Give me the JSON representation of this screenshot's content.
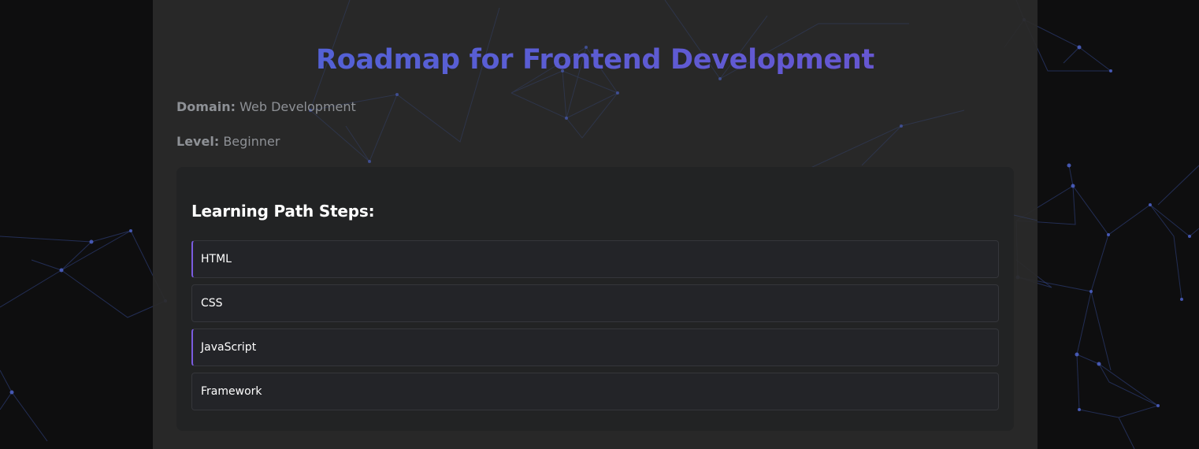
{
  "page": {
    "title": "Roadmap for Frontend Development"
  },
  "meta": {
    "domain_label": "Domain:",
    "domain_value": "Web Development",
    "level_label": "Level:",
    "level_value": "Beginner"
  },
  "steps": {
    "heading": "Learning Path Steps:",
    "items": [
      {
        "label": "HTML"
      },
      {
        "label": "CSS"
      },
      {
        "label": "JavaScript"
      },
      {
        "label": "Framework"
      }
    ]
  },
  "colors": {
    "title_gradient_start": "#4e64d6",
    "title_gradient_end": "#6b54d0",
    "accent": "#7b5ce0",
    "network_lines": "#3b4f9a"
  }
}
